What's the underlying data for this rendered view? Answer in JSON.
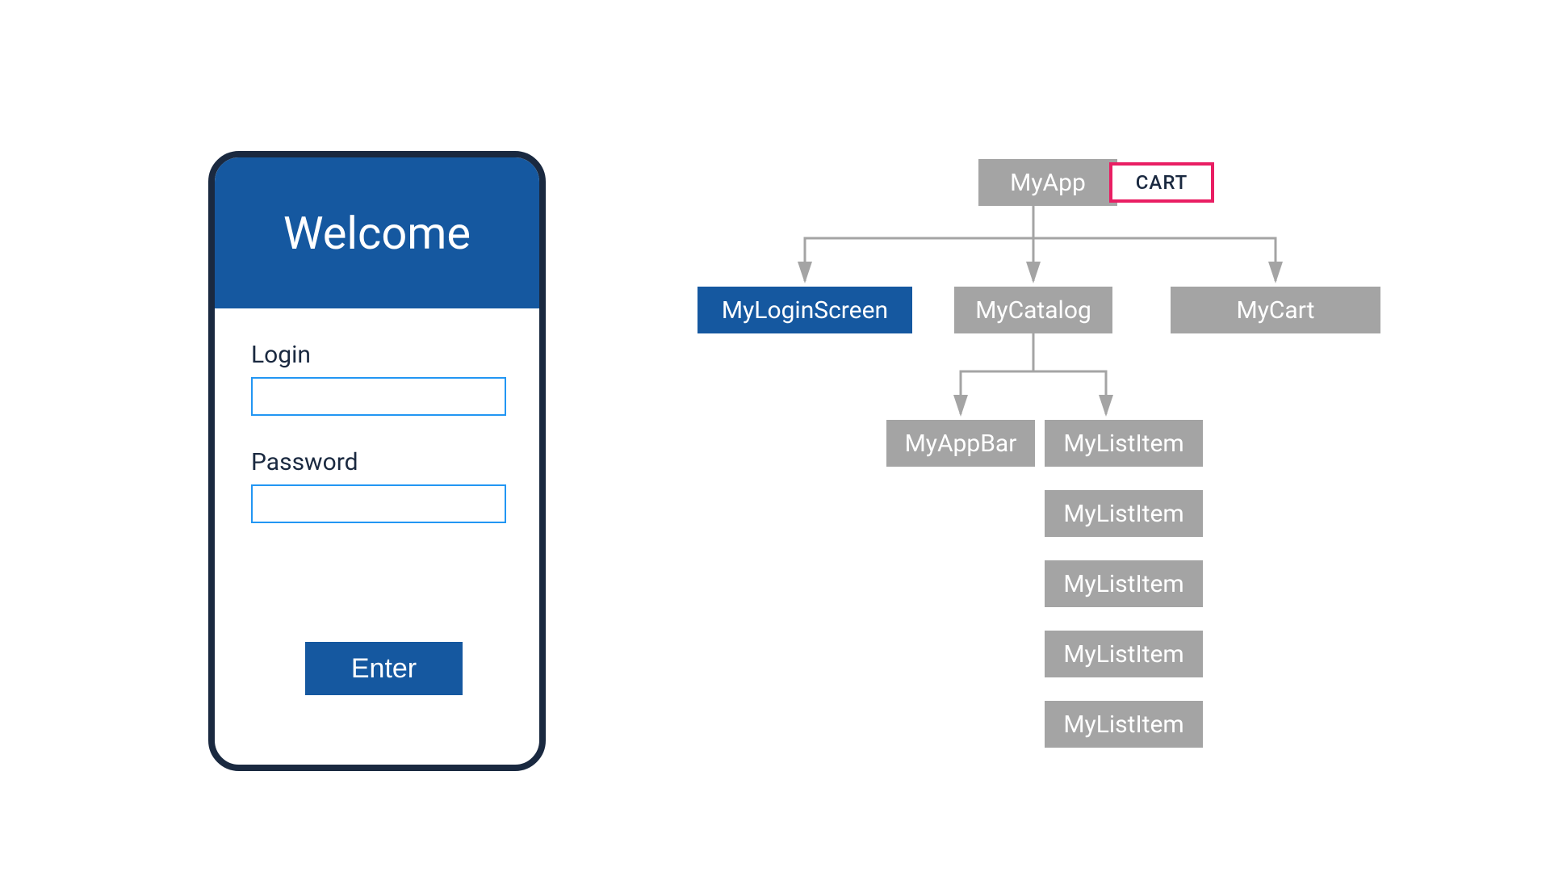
{
  "phone": {
    "header_title": "Welcome",
    "login_label": "Login",
    "password_label": "Password",
    "enter_button": "Enter"
  },
  "tree": {
    "root": "MyApp",
    "cart_tag": "CART",
    "children": [
      {
        "label": "MyLoginScreen",
        "highlighted": true
      },
      {
        "label": "MyCatalog",
        "children": [
          {
            "label": "MyAppBar"
          },
          {
            "label": "MyListItem"
          },
          {
            "label": "MyListItem"
          },
          {
            "label": "MyListItem"
          },
          {
            "label": "MyListItem"
          },
          {
            "label": "MyListItem"
          }
        ]
      },
      {
        "label": "MyCart"
      }
    ]
  },
  "colors": {
    "primary_blue": "#1558a0",
    "dark_navy": "#1a2940",
    "light_blue_border": "#2296f3",
    "gray_box": "#a4a4a4",
    "pink_outline": "#e91e63"
  }
}
